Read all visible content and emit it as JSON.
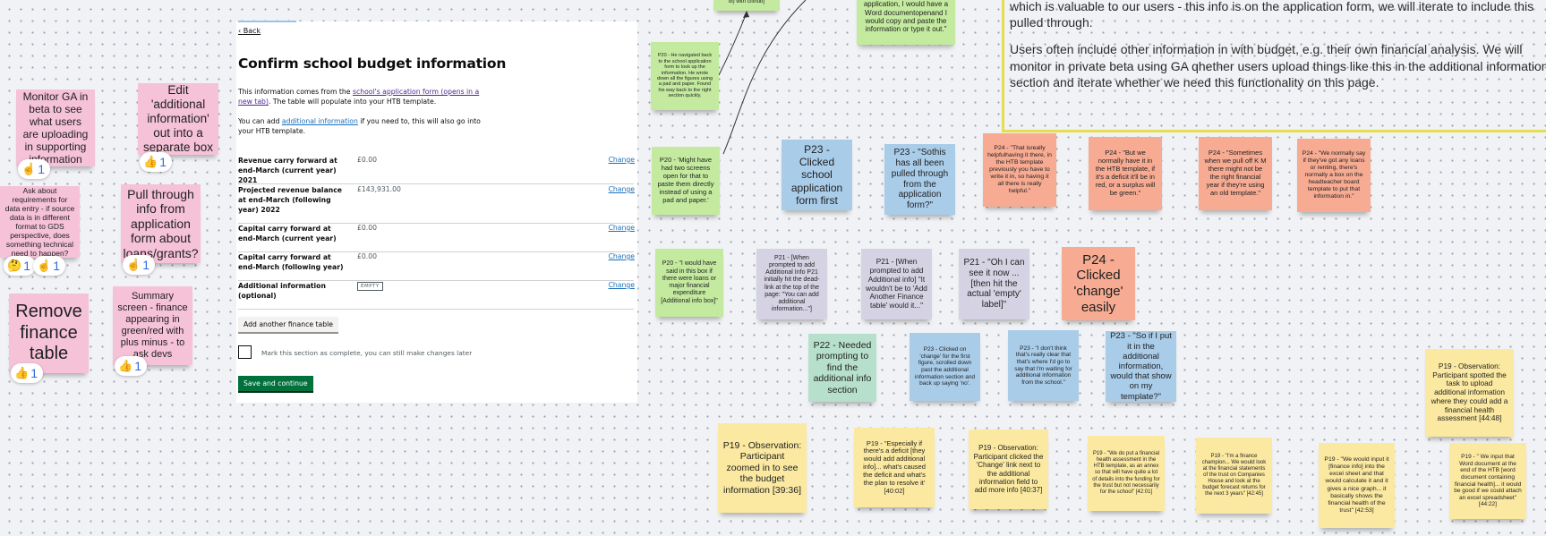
{
  "app_screenshot": {
    "back_link": "Back",
    "title": "Confirm school budget information",
    "intro_prefix": "This information comes from the ",
    "intro_link": "school's application form (opens in a new tab)",
    "intro_suffix": ". The table will populate into your HTB template.",
    "additional_prefix": "You can add ",
    "additional_link": "additional information",
    "additional_suffix": " if you need to, this will also go into your HTB template.",
    "rows": [
      {
        "key": "Revenue carry forward at end-March (current year) 2021",
        "value": "£0.00",
        "action": "Change"
      },
      {
        "key": "Projected revenue balance at end-March (following year) 2022",
        "value": "£143,931.00",
        "action": "Change"
      },
      {
        "key": "Capital carry forward at end-March (current year)",
        "value": "£0.00",
        "action": "Change"
      },
      {
        "key": "Capital carry forward at end-March (following year)",
        "value": "£0.00",
        "action": "Change"
      },
      {
        "key": "Additional information (optional)",
        "value": "EMPTY",
        "action": "Change"
      }
    ],
    "add_table_button": "Add another finance table",
    "checkbox_label": "Mark this section as complete, you can still make changes later",
    "save_button": "Save and continue"
  },
  "left_notes": [
    {
      "text": "Monitor GA in beta to see what users are uploading in supporting information",
      "reaction": {
        "emoji": "☝",
        "count": "1"
      }
    },
    {
      "text": "Edit 'additional information' out into a separate box",
      "reaction": {
        "emoji": "👍",
        "count": "1"
      }
    },
    {
      "text": "Ask about requirements for data entry - if source data is in different format to GDS perspective, does something technical need to happen?",
      "reactions": [
        {
          "emoji": "🤔",
          "count": "1"
        },
        {
          "emoji": "☝",
          "count": "1"
        }
      ]
    },
    {
      "text": "Pull through info from application form about loans/grants?",
      "reaction": {
        "emoji": "☝",
        "count": "1"
      }
    },
    {
      "text": "Remove finance table",
      "reaction": {
        "emoji": "👍",
        "count": "1"
      }
    },
    {
      "text": "Summary screen - finance appearing in green/red with plus minus - to ask devs",
      "reaction": {
        "emoji": "👍",
        "count": "1"
      }
    }
  ],
  "summary_note": {
    "p1": "which is valuable to our users - this info is on the application form, we will iterate to include this pulled through.",
    "p2": "Users often include other information in with budget, e.g. their own financial analysis. We will monitor in private beta using GA qhether users upload things like this in the additional information section and iterate whether we need this functionality on this page."
  },
  "research_notes": [
    {
      "id": "n-top-small",
      "color": "green",
      "text": "bl) with Github]"
    },
    {
      "id": "n-top-quote",
      "color": "green",
      "text": "application, I would have a Word documentopenand I would copy and paste the information or type it out.\""
    },
    {
      "id": "n-p20-nav",
      "color": "green",
      "text": "P20 - He navigated back to the school application form to look up the information. He wrote down all the figures using a pad and paper. Found his way back to the right section quickly."
    },
    {
      "id": "n-p20-screens",
      "color": "green",
      "text": "P20 - 'Might have had two screens open for that to paste them directly instead of using a pad and paper.'"
    },
    {
      "id": "n-p23-clicked",
      "color": "blue",
      "text": "P23 - Clicked school application form first"
    },
    {
      "id": "n-p23-sothis",
      "color": "blue",
      "text": "P23 - \"Sothis has all been pulled through from the application form?\""
    },
    {
      "id": "n-p24-helpful",
      "color": "salmon",
      "text": "P24 - \"That isreally helpfulhaving it there, in the HTB template previously you have to write it in, so having it all there is really helpful.\""
    },
    {
      "id": "n-p24-butwe",
      "color": "salmon",
      "text": "P24 - \"But we normally have it in the HTB template, if it's a deficit it'll be in red, or a surplus will be green.\""
    },
    {
      "id": "n-p24-sometimes",
      "color": "salmon",
      "text": "P24 - \"Sometimes when we pull off K M there might not be the right financial year if they're using an old template.\""
    },
    {
      "id": "n-p24-loans",
      "color": "salmon",
      "text": "P24 - \"We normally say if they've got any loans or renting, there's normally a box on the headteacher board template to put that information in.\""
    },
    {
      "id": "n-p20-wouldhave",
      "color": "green",
      "text": "P20 - \"I would have said in this box if there were loans or major financial expenditure [Additional info box]\""
    },
    {
      "id": "n-p21-deadlink",
      "color": "lilac",
      "text": "P21 - [When prompted to add Additional Info P21 initially hit the dead-link at the top of the page: \"You can add additional information...\"]"
    },
    {
      "id": "n-p21-addanother",
      "color": "lilac",
      "text": "P21 - [When prompted to add Additional info] \"It wouldn't be to 'Add Another Finance table' would it...\""
    },
    {
      "id": "n-p21-ohi",
      "color": "lilac",
      "text": "P21 - \"Oh I can see it now ... [then hit the actual 'empty' label]\""
    },
    {
      "id": "n-p24-change",
      "color": "salmon",
      "text": "P24 - Clicked 'change' easily"
    },
    {
      "id": "n-p22",
      "color": "mint",
      "text": "P22 - Needed prompting to find the additional info section"
    },
    {
      "id": "n-p23-changefirst",
      "color": "blue",
      "text": "P23 - Clicked on 'change' for the first figure, scrolled down past the additional information section and back up saying 'no'."
    },
    {
      "id": "n-p23-dontthink",
      "color": "blue",
      "text": "P23 - \"I don't think that's really clear that that's where I'd go to say that I'm waiting for additional information from the school.\""
    },
    {
      "id": "n-p23-soifi",
      "color": "blue",
      "text": "P23 - \"So if I put it in the additional information, would that show on my template?\""
    },
    {
      "id": "n-p19-zoomed",
      "color": "yellow",
      "text": "P19 - Observation: Participant zoomed in to see the budget information [39:36]"
    },
    {
      "id": "n-p19-deficit",
      "color": "yellow",
      "text": "P19 - \"Especially if there's a deficit [they would add additional info]... what's caused the deficit and what's the plan to resolve it' [40:02]"
    },
    {
      "id": "n-p19-clickedchange",
      "color": "yellow",
      "text": "P19 - Observation: Participant clicked the 'Change' link next to the additional information field to add more info [40:37]"
    },
    {
      "id": "n-p19-annex",
      "color": "yellow",
      "text": "P19 - \"We do put a financial health assessment in the HTB template, as an annex so that will have quite a lot of details into the funding for the trust but not necessarily for the school\" [42:01]"
    },
    {
      "id": "n-p19-champion",
      "color": "yellow",
      "text": "P19 - \"I'm a finance champion... We would look at the financial statements of the trust on Companies House and look at the budget forecast returns for the next 3 years\" [42:45]"
    },
    {
      "id": "n-p19-excel",
      "color": "yellow",
      "text": "P19 - \"We would input it [finance info] into the excel sheet and that would calculate it and it gives a nice graph... it basically shows the financial health of the trust\" [42:53]"
    },
    {
      "id": "n-p19-spotted",
      "color": "yellow",
      "text": "P19 - Observation: Participant spotted the task to upload additional information where they could add a financial health assessment [44:48]"
    },
    {
      "id": "n-p19-word",
      "color": "yellow",
      "text": "P19 - \" We input that Word document at the end of the HTB [word document containing financial health]... it would be good if we could attach an excel spreadsheet\" [44:22]"
    }
  ]
}
